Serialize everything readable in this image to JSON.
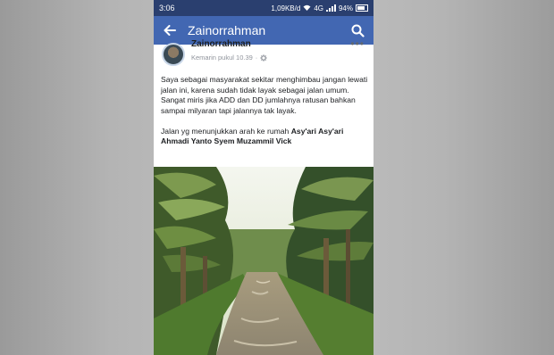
{
  "status_bar": {
    "time": "3:06",
    "network_speed": "1,09KB/d",
    "network_type": "4G",
    "battery": "94%"
  },
  "app_bar": {
    "title": "Zainorrahman",
    "back_icon": "arrow-left-icon",
    "search_icon": "search-icon"
  },
  "post": {
    "author": "Zainorrahman",
    "timestamp": "Kemarin pukul 10.39",
    "privacy_icon": "gear-icon",
    "more_label": "•••",
    "text_para1": "Saya sebagai masyarakat sekitar menghimbau jangan lewati jalan ini, karena sudah tidak layak sebagai jalan umum.",
    "text_para2": "Sangat miris jika ADD dan DD jumlahnya ratusan bahkan sampai milyaran tapi jalannya tak layak.",
    "text_para3_prefix": "Jalan yg menunjukkan arah ke rumah ",
    "tag1": "Asy'ari Asy'ari",
    "tag2": "Ahmadi Yanto",
    "tag3": "Syem Muzammil Vick"
  },
  "colors": {
    "status_bar": "#2a3f6f",
    "app_bar": "#4267b2",
    "text": "#1c1e21",
    "meta": "#90949c"
  }
}
